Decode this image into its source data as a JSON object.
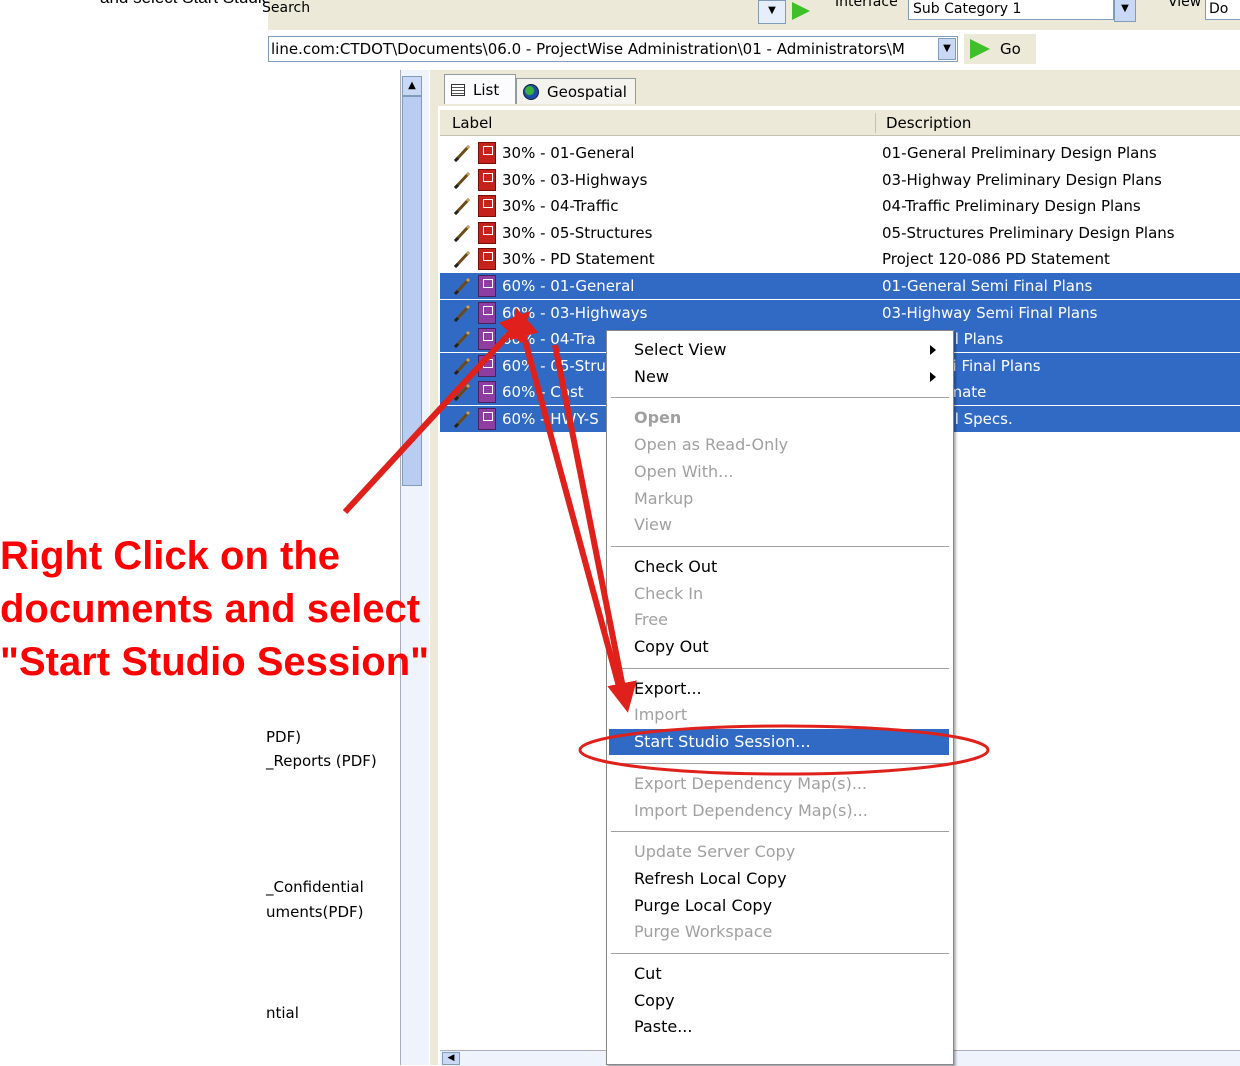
{
  "caption": "and select Start Studio Session.",
  "toolbar": {
    "search_label": "Search",
    "interface_label": "Interface",
    "interface_value": "Sub Category 1",
    "view_label": "View",
    "view_value": "Do"
  },
  "address_bar": {
    "path": "line.com:CTDOT\\Documents\\06.0 - ProjectWise Administration\\01 - Administrators\\M",
    "go_label": "Go"
  },
  "left_panel": {
    "items": [
      "PDF)",
      "_Reports (PDF)",
      "_Confidential",
      "uments(PDF)",
      "ntial"
    ]
  },
  "tabs": [
    {
      "label": "List",
      "icon": "list-icon"
    },
    {
      "label": "Geospatial",
      "icon": "globe-icon"
    }
  ],
  "columns": {
    "label": "Label",
    "description": "Description"
  },
  "rows": [
    {
      "label": "30% - 01-General",
      "description": "01-General Preliminary Design Plans",
      "selected": false
    },
    {
      "label": "30% - 03-Highways",
      "description": "03-Highway Preliminary Design Plans",
      "selected": false
    },
    {
      "label": "30% - 04-Traffic",
      "description": "04-Traffic Preliminary Design Plans",
      "selected": false
    },
    {
      "label": "30% - 05-Structures",
      "description": "05-Structures Preliminary Design Plans",
      "selected": false
    },
    {
      "label": "30% - PD Statement",
      "description": "Project 120-086 PD Statement",
      "selected": false
    },
    {
      "label": "60% - 01-General",
      "description": "01-General Semi Final Plans",
      "selected": true
    },
    {
      "label": "60% - 03-Highways",
      "description": "03-Highway Semi Final Plans",
      "selected": true
    },
    {
      "label": "60% - 04-Tra",
      "description": "Semi Final Plans",
      "selected": true
    },
    {
      "label": "60% - 05-Stru",
      "description": "ures Semi Final Plans",
      "selected": true
    },
    {
      "label": "60% - Cost",
      "description": "Cost Estimate",
      "selected": true
    },
    {
      "label": "60% - HWY-S",
      "description": "Semi Final Specs.",
      "selected": true
    }
  ],
  "context_menu": {
    "groups": [
      [
        {
          "label": "Select View",
          "submenu": true,
          "disabled": false
        },
        {
          "label": "New",
          "submenu": true,
          "disabled": false
        }
      ],
      [
        {
          "label": "Open",
          "disabled": true,
          "bold": true
        },
        {
          "label": "Open as Read-Only",
          "disabled": true
        },
        {
          "label": "Open With...",
          "disabled": true
        },
        {
          "label": "Markup",
          "disabled": true
        },
        {
          "label": "View",
          "disabled": true
        }
      ],
      [
        {
          "label": "Check Out",
          "disabled": false
        },
        {
          "label": "Check In",
          "disabled": true
        },
        {
          "label": "Free",
          "disabled": true
        },
        {
          "label": "Copy Out",
          "disabled": false
        }
      ],
      [
        {
          "label": "Export...",
          "disabled": false
        },
        {
          "label": "Import",
          "disabled": true
        },
        {
          "label": "Start Studio Session...",
          "disabled": false,
          "highlighted": true
        }
      ],
      [
        {
          "label": "Export Dependency Map(s)...",
          "disabled": true
        },
        {
          "label": "Import Dependency Map(s)...",
          "disabled": true
        }
      ],
      [
        {
          "label": "Update Server Copy",
          "disabled": true
        },
        {
          "label": "Refresh Local Copy",
          "disabled": false
        },
        {
          "label": "Purge Local Copy",
          "disabled": false
        },
        {
          "label": "Purge Workspace",
          "disabled": true
        }
      ],
      [
        {
          "label": "Cut",
          "disabled": false
        },
        {
          "label": "Copy",
          "disabled": false
        },
        {
          "label": "Paste...",
          "disabled": false
        }
      ]
    ]
  },
  "annotation": {
    "lines": [
      "Right Click on the",
      "documents and select",
      "\"Start Studio Session\""
    ],
    "color": "#ff0000"
  },
  "colors": {
    "selection": "#316ac5",
    "highlight_circle": "#e0201a"
  }
}
